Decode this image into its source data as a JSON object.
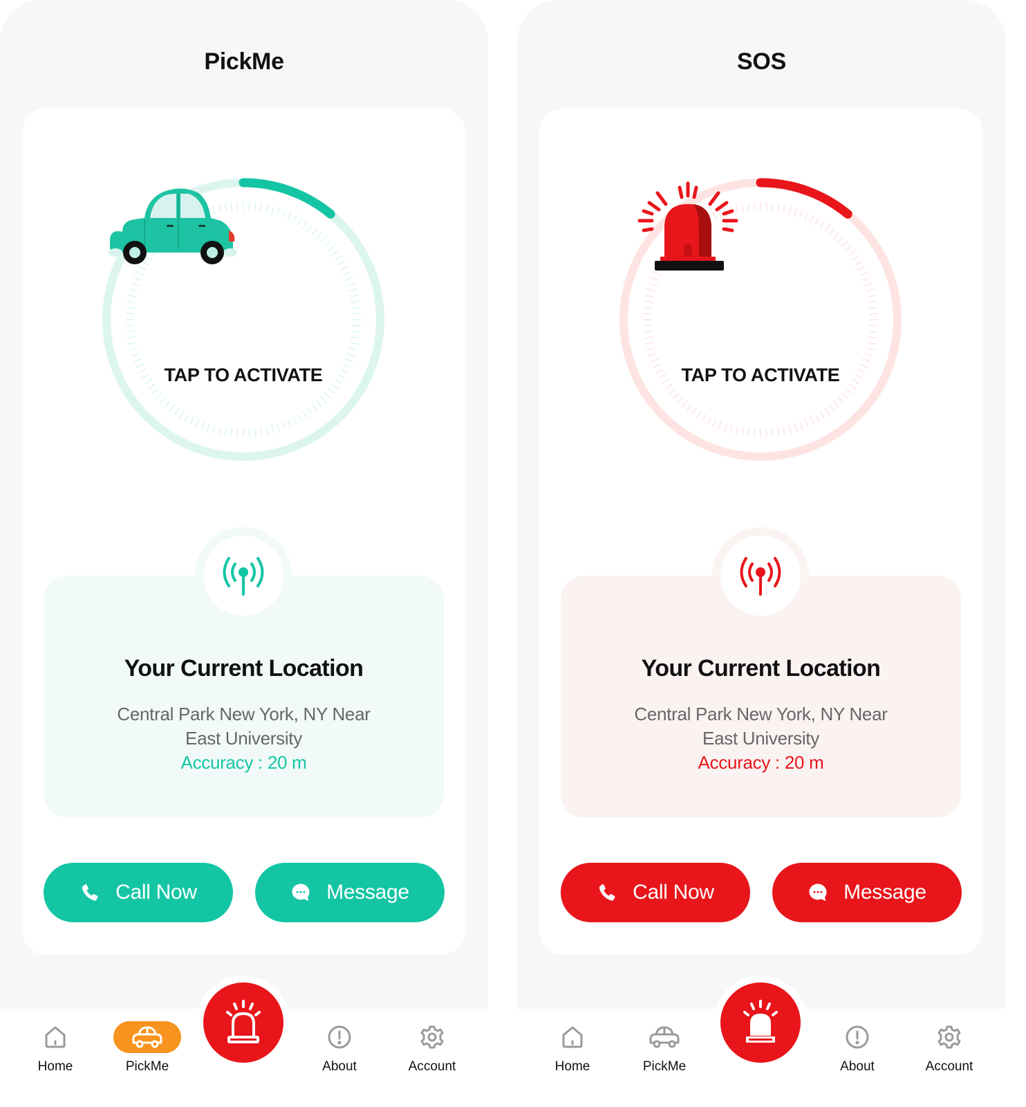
{
  "colors": {
    "teal": "#14c5a4",
    "teal_light": "#dcf5ef",
    "teal_card_bg": "#f1faf8",
    "red": "#e8151b",
    "red_light": "#fde4e3",
    "red_card_bg": "#fbf3f2",
    "orange": "#f7931e",
    "nav_icon_gray": "#9a9a9a"
  },
  "screens": [
    {
      "id": "pickme",
      "title": "PickMe",
      "theme": "teal",
      "hero_icon": "car-icon",
      "activate_label": "TAP TO ACTIVATE",
      "progress_fraction": 0.11,
      "location": {
        "title": "Your Current Location",
        "address": "Central Park New York, NY Near East University",
        "accuracy": "Accuracy : 20 m"
      },
      "buttons": {
        "call": "Call Now",
        "message": "Message"
      },
      "nav_active": "PickMe"
    },
    {
      "id": "sos",
      "title": "SOS",
      "theme": "red",
      "hero_icon": "siren-icon",
      "activate_label": "TAP TO ACTIVATE",
      "progress_fraction": 0.11,
      "location": {
        "title": "Your Current Location",
        "address": "Central Park New York, NY Near East University",
        "accuracy": "Accuracy : 20 m"
      },
      "buttons": {
        "call": "Call Now",
        "message": "Message"
      },
      "nav_active": "SOS"
    }
  ],
  "nav": {
    "items": [
      {
        "label": "Home",
        "icon": "home-icon"
      },
      {
        "label": "PickMe",
        "icon": "car-icon"
      },
      {
        "label": "About",
        "icon": "info-icon"
      },
      {
        "label": "Account",
        "icon": "gear-icon"
      }
    ],
    "center_icon": "siren-icon"
  }
}
